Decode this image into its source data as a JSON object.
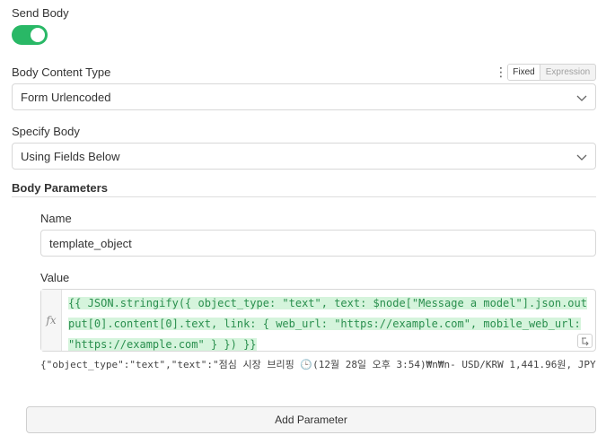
{
  "send_body": {
    "label": "Send Body",
    "enabled": true,
    "accent_color": "#29b866"
  },
  "body_content_type": {
    "label": "Body Content Type",
    "value": "Form Urlencoded",
    "mode_fixed": "Fixed",
    "mode_expression": "Expression",
    "kebab": "⋮"
  },
  "specify_body": {
    "label": "Specify Body",
    "value": "Using Fields Below"
  },
  "body_parameters": {
    "label": "Body Parameters",
    "name_label": "Name",
    "name_value": "template_object",
    "value_label": "Value",
    "fx_symbol": "fx",
    "expression": "{{ JSON.stringify({   object_type: \"text\",   text: $node[\"Message a model\"].json.output[0].content[0].text,   link: {     web_url: \"https://example.com\",     mobile_web_url: \"https://example.com\"   } }) }}",
    "result_preview": "{\"object_type\":\"text\",\"text\":\"점심 시장 브리핑 🕒(12월 28일 오후 3:54)₩n₩n- USD/KRW 1,441.96원, JPY/…",
    "add_button": "Add Parameter"
  },
  "icons": [
    "chevron-down-icon",
    "kebab-menu-icon",
    "expand-icon"
  ]
}
